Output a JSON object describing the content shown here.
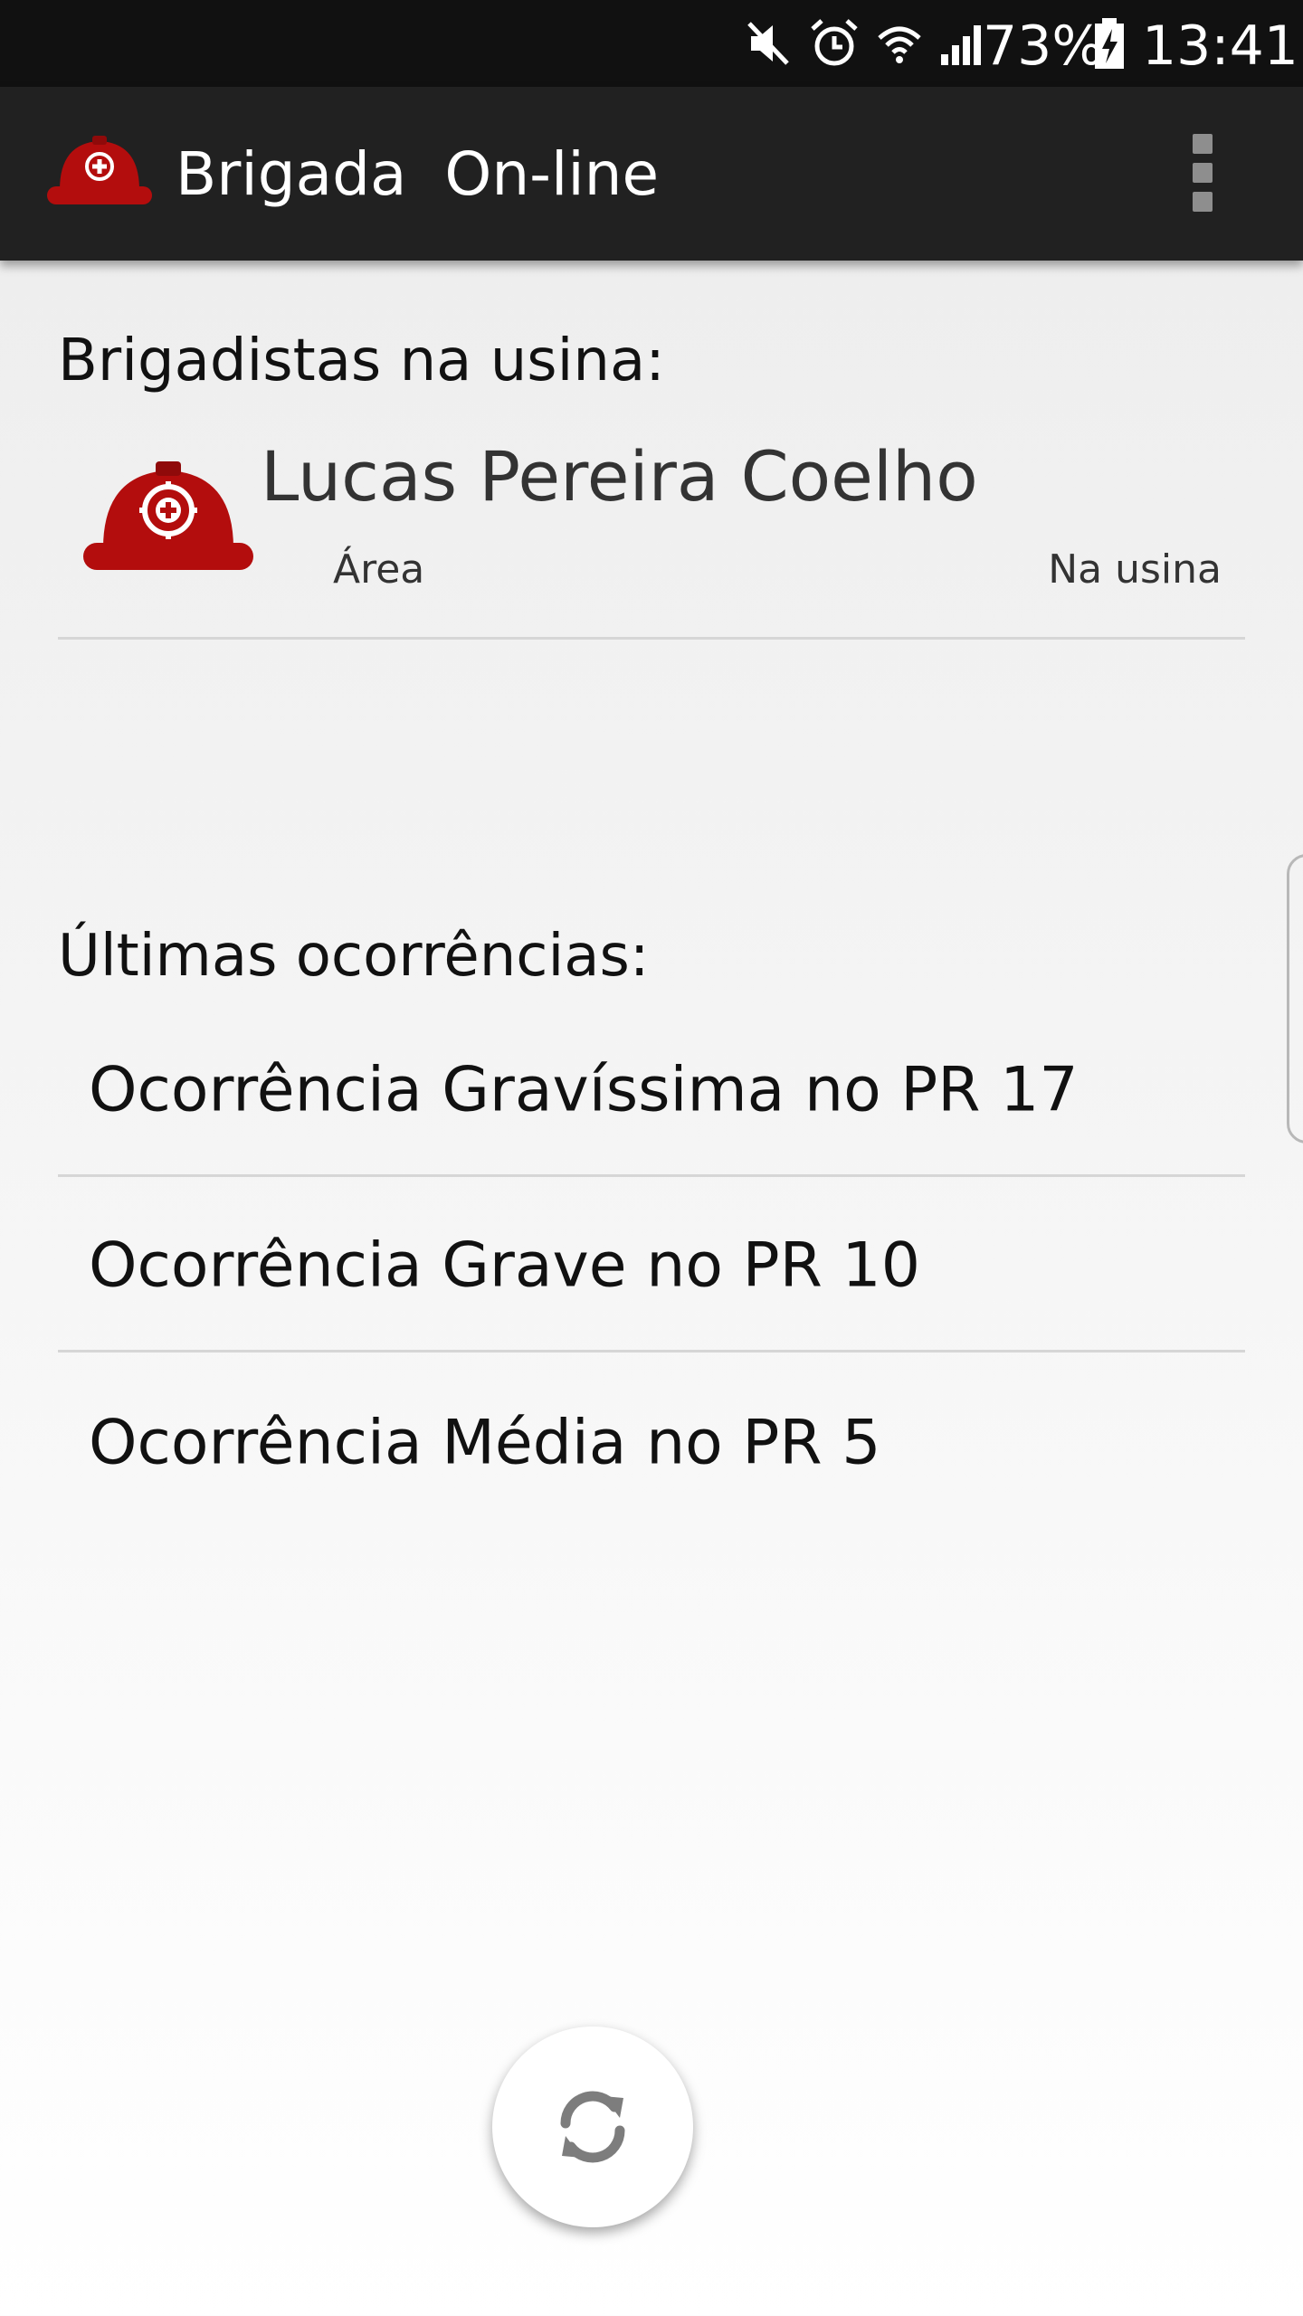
{
  "status_bar": {
    "battery_percent": "73%",
    "time": "13:41",
    "icons": [
      "mute-icon",
      "alarm-icon",
      "wifi-icon",
      "signal-icon",
      "battery-charging-icon"
    ]
  },
  "toolbar": {
    "title": "Brigada  On-line",
    "logo_icon": "helmet-icon",
    "menu_icon": "overflow-menu-icon"
  },
  "brigadistas": {
    "heading": "Brigadistas na usina:",
    "items": [
      {
        "name": "Lucas Pereira Coelho",
        "area": "Área",
        "status": "Na usina"
      }
    ]
  },
  "ocorrencias": {
    "heading": "Últimas ocorrências:",
    "items": [
      {
        "label": "Ocorrência Gravíssima no PR 17"
      },
      {
        "label": "Ocorrência Grave no PR 10"
      },
      {
        "label": "Ocorrência Média no PR 5"
      }
    ]
  },
  "fab": {
    "icon": "refresh-icon"
  },
  "colors": {
    "helmet": "#b30d0d",
    "toolbar": "#212121",
    "statusbar": "#111111"
  }
}
